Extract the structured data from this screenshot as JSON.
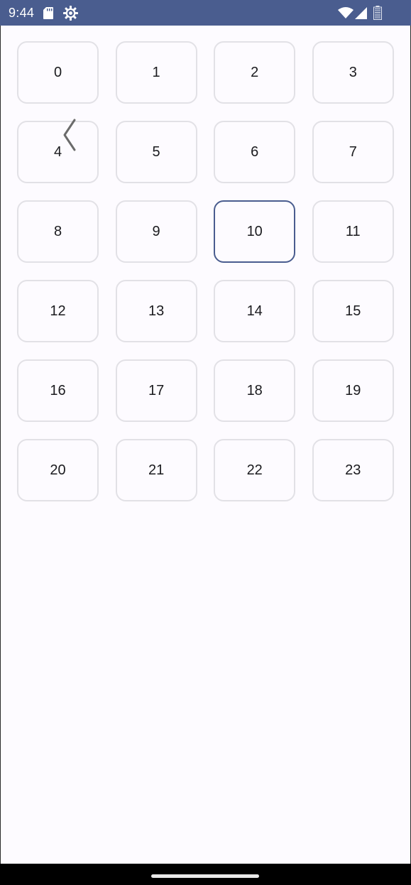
{
  "status_bar": {
    "time": "9:44",
    "left_icons": [
      "sd-card-icon",
      "settings-gear-icon"
    ],
    "right_icons": [
      "wifi-icon",
      "signal-icon",
      "battery-icon"
    ],
    "background": "#4a5d8f"
  },
  "grid": {
    "items": [
      "0",
      "1",
      "2",
      "3",
      "4",
      "5",
      "6",
      "7",
      "8",
      "9",
      "10",
      "11",
      "12",
      "13",
      "14",
      "15",
      "16",
      "17",
      "18",
      "19",
      "20",
      "21",
      "22",
      "23"
    ],
    "selected_index": 10,
    "selected_border_color": "#4a5d8f",
    "border_color": "#e2e1e6"
  },
  "overlay": {
    "back_gesture_icon": "chevron-left-icon"
  },
  "navigation_bar": {
    "home_handle_icon": "home-handle"
  }
}
